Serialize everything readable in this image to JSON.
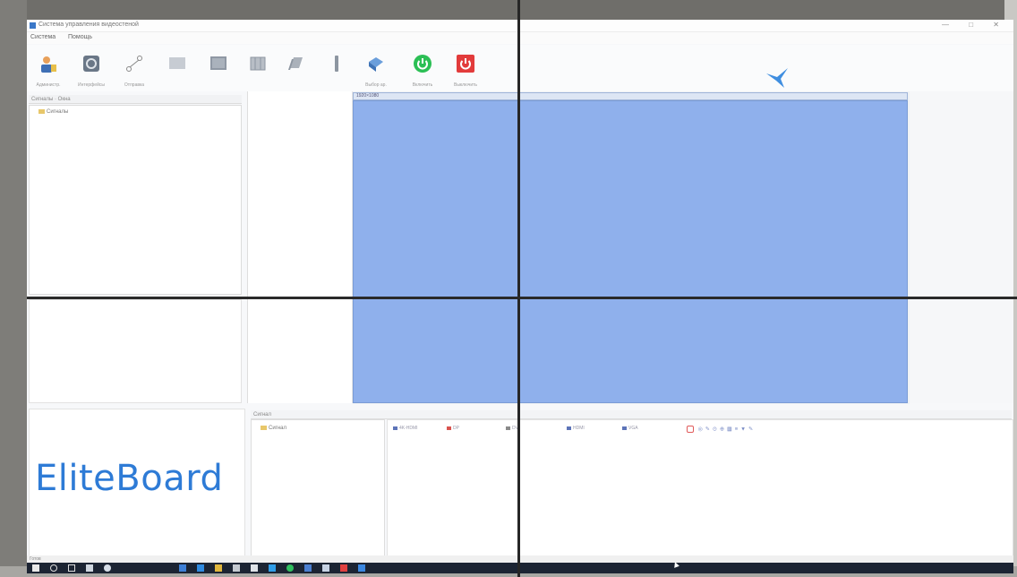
{
  "window": {
    "title": "Система управления видеостеной",
    "controls": "— □ ✕"
  },
  "menu": [
    "Система",
    "Помощь"
  ],
  "toolbar": [
    {
      "label": "Администр.",
      "icon": "user-admin-icon"
    },
    {
      "label": "Интерфейсы",
      "icon": "gear-chip-icon"
    },
    {
      "label": "Отправка",
      "icon": "network-nodes-icon"
    },
    {
      "label": "",
      "icon": "display-icon"
    },
    {
      "label": "",
      "icon": "monitor-icon"
    },
    {
      "label": "",
      "icon": "wall-icon"
    },
    {
      "label": "",
      "icon": "layers-icon"
    },
    {
      "label": "",
      "icon": "stick-icon"
    },
    {
      "label": "Выбор ар.",
      "icon": "cube-icon"
    },
    {
      "label": "Включить",
      "icon": "power-on-icon"
    },
    {
      "label": "Выключить",
      "icon": "power-off-icon"
    }
  ],
  "tree_panel": {
    "header": "Сигналы · Окна",
    "root": "Сигналы"
  },
  "canvas": {
    "header": "1920×1080"
  },
  "brand": "EliteBoard",
  "signals_panel": {
    "header": "Сигнал",
    "root": "Сигнал",
    "items": [
      {
        "label": "4K-HDMI",
        "color": "#5d74b8"
      },
      {
        "label": "DP",
        "color": "#d9534f"
      },
      {
        "label": "DVI",
        "color": "#8a8a8a"
      },
      {
        "label": "HDMI",
        "color": "#5d74b8"
      },
      {
        "label": "VGA",
        "color": "#5d74b8"
      }
    ],
    "mini_tools": "◎✎⊙⊕▦≡▼✎"
  },
  "status": "Готов",
  "colors": {
    "canvas_blue": "#8fb0ec",
    "brand_blue": "#2e7bd6",
    "power_on": "#2bbf55",
    "power_off": "#e23b3b"
  }
}
